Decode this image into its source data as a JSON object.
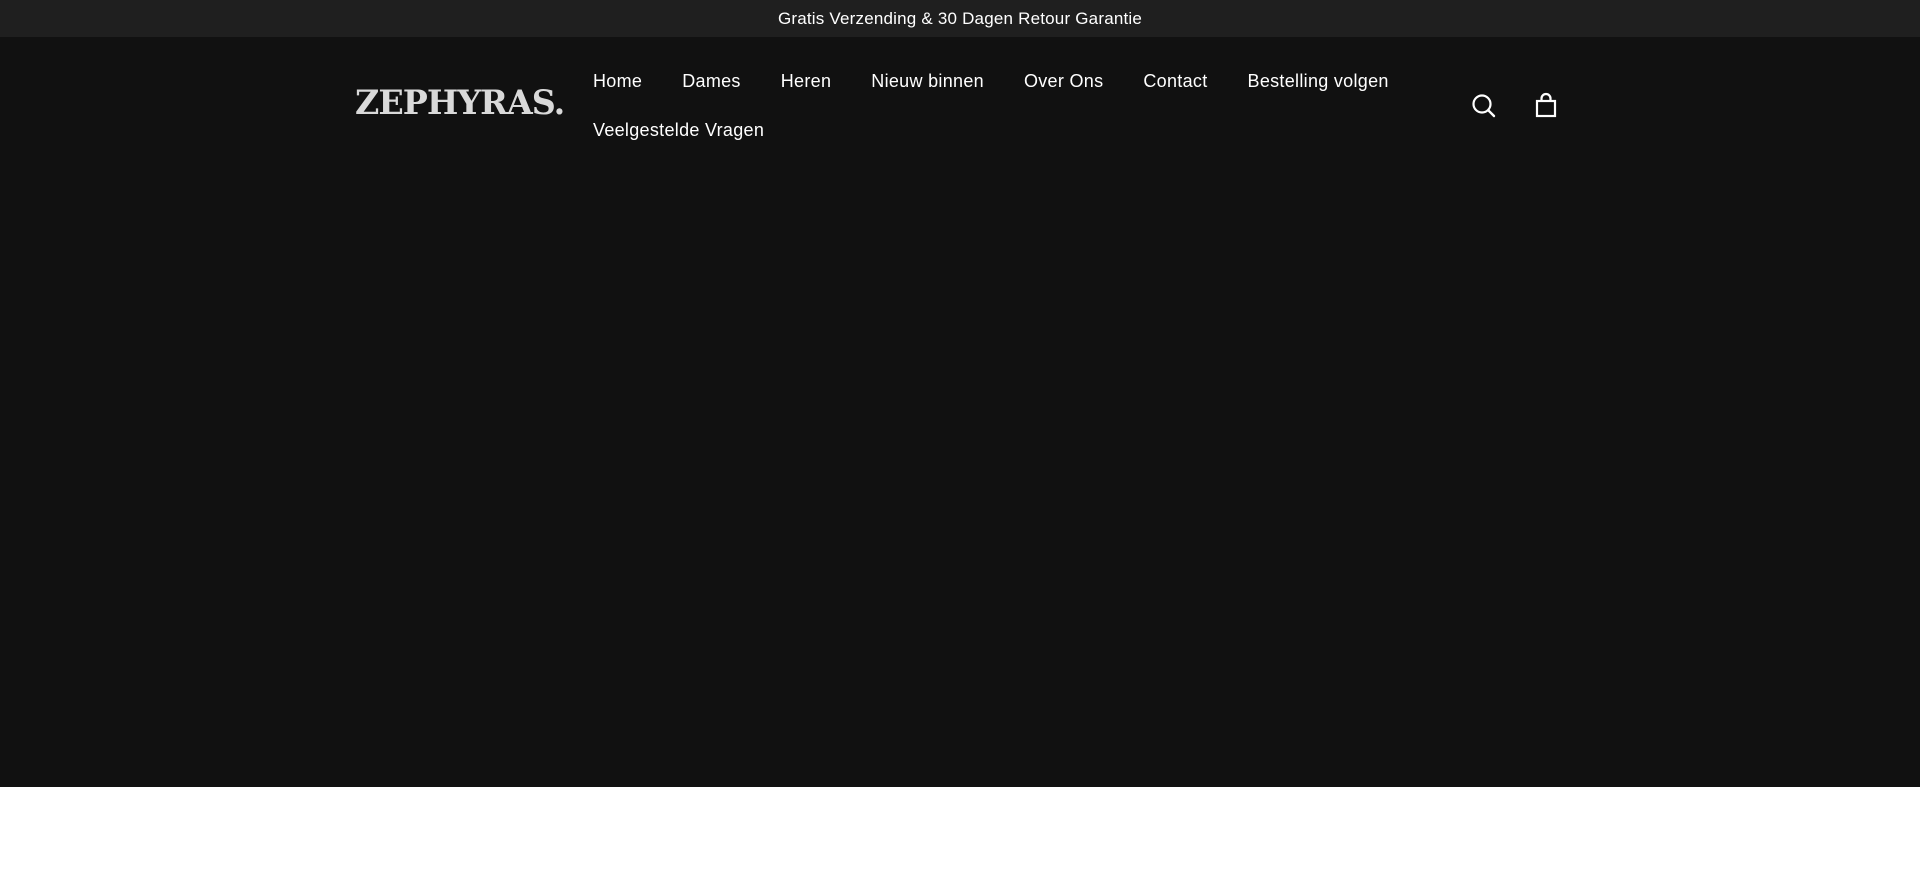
{
  "announcement": {
    "text": "Gratis Verzending & 30 Dagen Retour Garantie"
  },
  "header": {
    "logo_text": "ZEPHYRAS.",
    "nav_row_1": [
      "Home",
      "Dames",
      "Heren",
      "Nieuw binnen",
      "Over Ons",
      "Contact",
      "Bestelling volgen"
    ],
    "nav_row_2": [
      "Veelgestelde Vragen"
    ],
    "icons": [
      "search-icon",
      "cart-icon"
    ]
  },
  "colors": {
    "announcement_bg": "#1f1f1f",
    "hero_bg": "#111111",
    "text": "#ffffff",
    "logo": "#d9d9d9"
  }
}
